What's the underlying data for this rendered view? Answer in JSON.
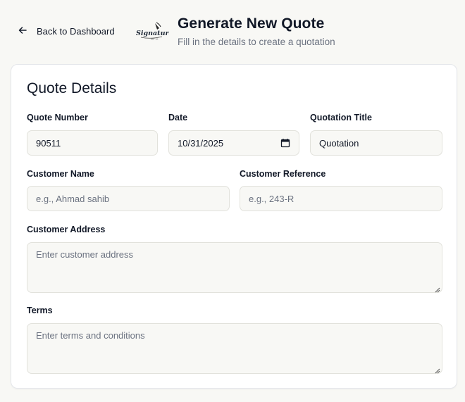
{
  "header": {
    "back_label": "Back to Dashboard",
    "title": "Generate New Quote",
    "subtitle": "Fill in the details to create a quotation",
    "logo_text": "Signature"
  },
  "form": {
    "title": "Quote Details",
    "quote_number": {
      "label": "Quote Number",
      "value": "90511"
    },
    "date": {
      "label": "Date",
      "value": "10/31/2025"
    },
    "quotation_title": {
      "label": "Quotation Title",
      "value": "Quotation"
    },
    "customer_name": {
      "label": "Customer Name",
      "placeholder": "e.g., Ahmad sahib"
    },
    "customer_reference": {
      "label": "Customer Reference",
      "placeholder": "e.g., 243-R"
    },
    "customer_address": {
      "label": "Customer Address",
      "placeholder": "Enter customer address"
    },
    "terms": {
      "label": "Terms",
      "placeholder": "Enter terms and conditions"
    }
  },
  "colors": {
    "background": "#f8f8f5",
    "card": "#ffffff",
    "field": "#f8f8f5",
    "border": "#e2e2dc",
    "muted_text": "#6b7280"
  }
}
